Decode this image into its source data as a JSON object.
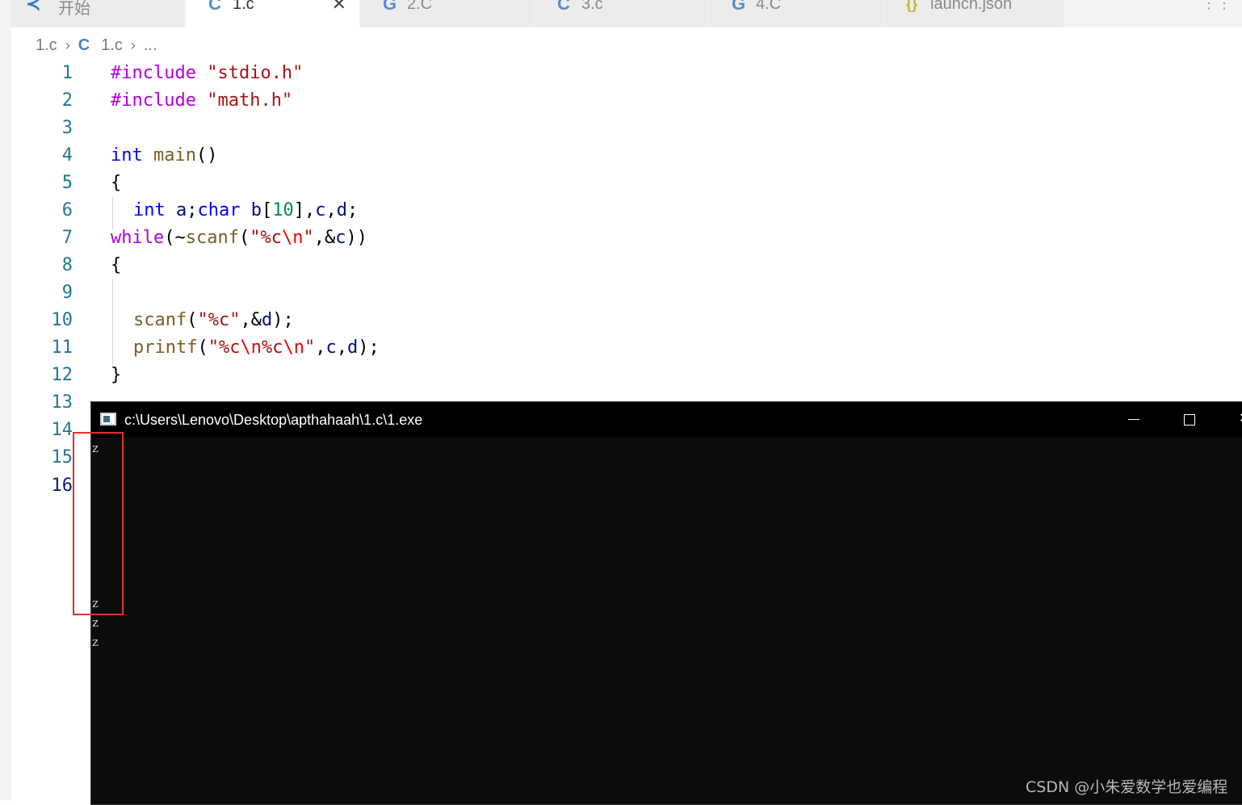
{
  "tabs": [
    {
      "icon": "vscode-logo-icon",
      "label": "开始"
    },
    {
      "icon": "c-file-icon",
      "label": "1.c",
      "active": true
    },
    {
      "icon": "cpp-file-icon",
      "label": "2.C"
    },
    {
      "icon": "c-file-icon",
      "label": "3.c"
    },
    {
      "icon": "cpp-file-icon",
      "label": "4.C"
    },
    {
      "icon": "json-file-icon",
      "label": "launch.json"
    }
  ],
  "breadcrumb": {
    "folder": "1.c",
    "file": "1.c",
    "symbol": "..."
  },
  "editor": {
    "lines": [
      {
        "n": "1"
      },
      {
        "n": "2"
      },
      {
        "n": "3"
      },
      {
        "n": "4"
      },
      {
        "n": "5"
      },
      {
        "n": "6"
      },
      {
        "n": "7"
      },
      {
        "n": "8"
      },
      {
        "n": "9"
      },
      {
        "n": "10"
      },
      {
        "n": "11"
      },
      {
        "n": "12"
      },
      {
        "n": "13"
      },
      {
        "n": "14"
      },
      {
        "n": "15"
      },
      {
        "n": "16"
      }
    ],
    "code": {
      "l1": [
        "#include",
        " ",
        "\"stdio.h\""
      ],
      "l2": [
        "#include",
        " ",
        "\"math.h\""
      ],
      "l4": [
        "int",
        " ",
        "main",
        "()"
      ],
      "l5": [
        "{"
      ],
      "l6": [
        "int",
        " ",
        "a",
        ";",
        "char",
        " ",
        "b",
        "[",
        "10",
        "],",
        "c",
        ",",
        "d",
        ";"
      ],
      "l7": [
        "while",
        "(~",
        "scanf",
        "(",
        "\"%c",
        "\\n",
        "\"",
        ",&",
        "c",
        "))"
      ],
      "l8": [
        "{"
      ],
      "l10": [
        "scanf",
        "(",
        "\"%c\"",
        ",&",
        "d",
        ");"
      ],
      "l11": [
        "printf",
        "(",
        "\"%c",
        "\\n",
        "%c",
        "\\n",
        "\"",
        ",",
        "c",
        ",",
        "d",
        ");"
      ],
      "l12": [
        "}"
      ]
    }
  },
  "console": {
    "title": "c:\\Users\\Lenovo\\Desktop\\apthahaah\\1.c\\1.exe",
    "output": [
      "z",
      "z",
      "z",
      "z"
    ]
  },
  "watermark": "CSDN @小朱爱数学也爱编程",
  "colors": {
    "highlight": "#e2312e",
    "console_bg": "#0c0c0c",
    "line_number": "#237893"
  }
}
